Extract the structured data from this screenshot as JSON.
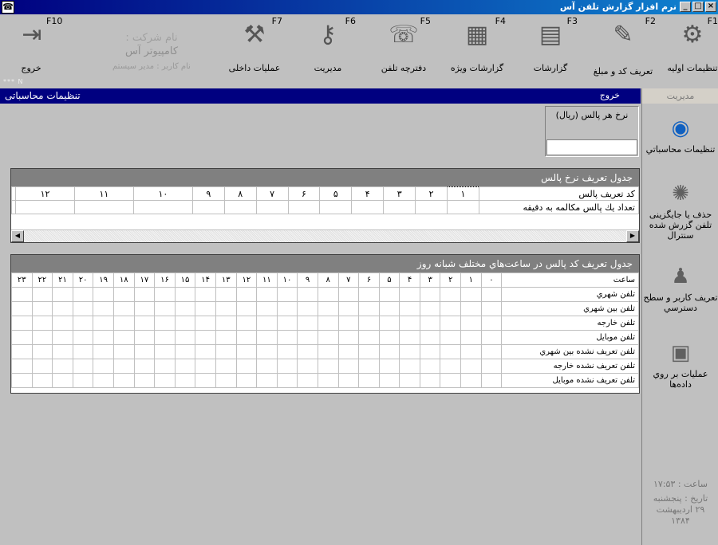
{
  "window": {
    "title": "نرم افزار گزارش تلفن آس",
    "app_icon": "☎",
    "buttons": [
      "×",
      "□",
      "_"
    ]
  },
  "toolbar": {
    "items": [
      {
        "key": "F1",
        "label": "تنظیمات اولیه",
        "icon": "settings-disk-icon",
        "glyph": "⚙"
      },
      {
        "key": "F2",
        "label": "تعریف کد و مبلغ",
        "icon": "define-code-icon",
        "glyph": "✎"
      },
      {
        "key": "F3",
        "label": "گزارشات",
        "icon": "reports-icon",
        "glyph": "▤"
      },
      {
        "key": "F4",
        "label": "گزارشات ویژه",
        "icon": "special-reports-icon",
        "glyph": "▦"
      },
      {
        "key": "F5",
        "label": "دفترچه تلفن",
        "icon": "phonebook-icon",
        "glyph": "☏"
      },
      {
        "key": "F6",
        "label": "مدیریت",
        "icon": "keys-icon",
        "glyph": "⚷"
      },
      {
        "key": "F7",
        "label": "عملیات داخلی",
        "icon": "internal-ops-icon",
        "glyph": "⚒"
      },
      {
        "key": "F10",
        "label": "خروج",
        "icon": "exit-door-icon",
        "glyph": "⇥"
      }
    ],
    "company": {
      "label": "نام شرکت :",
      "name": "کامپیوتر آس",
      "user": "نام کاربر : مدیر سیستم"
    }
  },
  "status_dots": "*** N",
  "section": {
    "title": "تنظیمات محاسباتی",
    "exit_label": "خروج"
  },
  "sidebar": {
    "header": "مدیریت",
    "items": [
      {
        "label": "تنظیمات محاسباتي",
        "icon": "globe-settings-icon",
        "glyph": "◉"
      },
      {
        "label": "حذف یا جایگزینی تلفن گزرش شده سنترال",
        "icon": "atom-icon",
        "glyph": "✺"
      },
      {
        "label": "تعریف کاربر و سطح دسترسي",
        "icon": "user-network-icon",
        "glyph": "♟"
      },
      {
        "label": "عملیات بر روي داده‌ها",
        "icon": "database-ops-icon",
        "glyph": "▣"
      }
    ],
    "time": "ساعت : ۱۷:۵۳",
    "date_label": "تاریخ : پنجشنبه",
    "date_value": "۲۹ اردیبهشت",
    "year": "۱۳۸۴"
  },
  "rate_box": {
    "label": "نرخ هر پالس (ریال)",
    "value": ""
  },
  "pulse_table": {
    "title": "جدول تعریف نرخ پالس",
    "row1_label": "کد تعریف پالس",
    "row2_label": "تعداد یك پالس مکالمه به دقیقه",
    "codes": [
      "۱",
      "۲",
      "۳",
      "۴",
      "۵",
      "۶",
      "۷",
      "۸",
      "۹",
      "۱۰",
      "۱۱",
      "۱۲"
    ]
  },
  "hours_table": {
    "title": "جدول تعریف کد پالس در ساعت‌هاي مختلف شبانه روز",
    "hour_label": "ساعت",
    "hours": [
      "۰",
      "۱",
      "۲",
      "۳",
      "۴",
      "۵",
      "۶",
      "۷",
      "۸",
      "۹",
      "۱۰",
      "۱۱",
      "۱۲",
      "۱۳",
      "۱۴",
      "۱۵",
      "۱۶",
      "۱۷",
      "۱۸",
      "۱۹",
      "۲۰",
      "۲۱",
      "۲۲",
      "۲۳"
    ],
    "rows": [
      "تلفن شهري",
      "تلفن بین شهري",
      "تلفن خارجه",
      "تلفن موبایل",
      "تلفن تعریف نشده بین شهري",
      "تلفن تعریف نشده خارجه",
      "تلفن تعریف نشده موبایل"
    ]
  }
}
